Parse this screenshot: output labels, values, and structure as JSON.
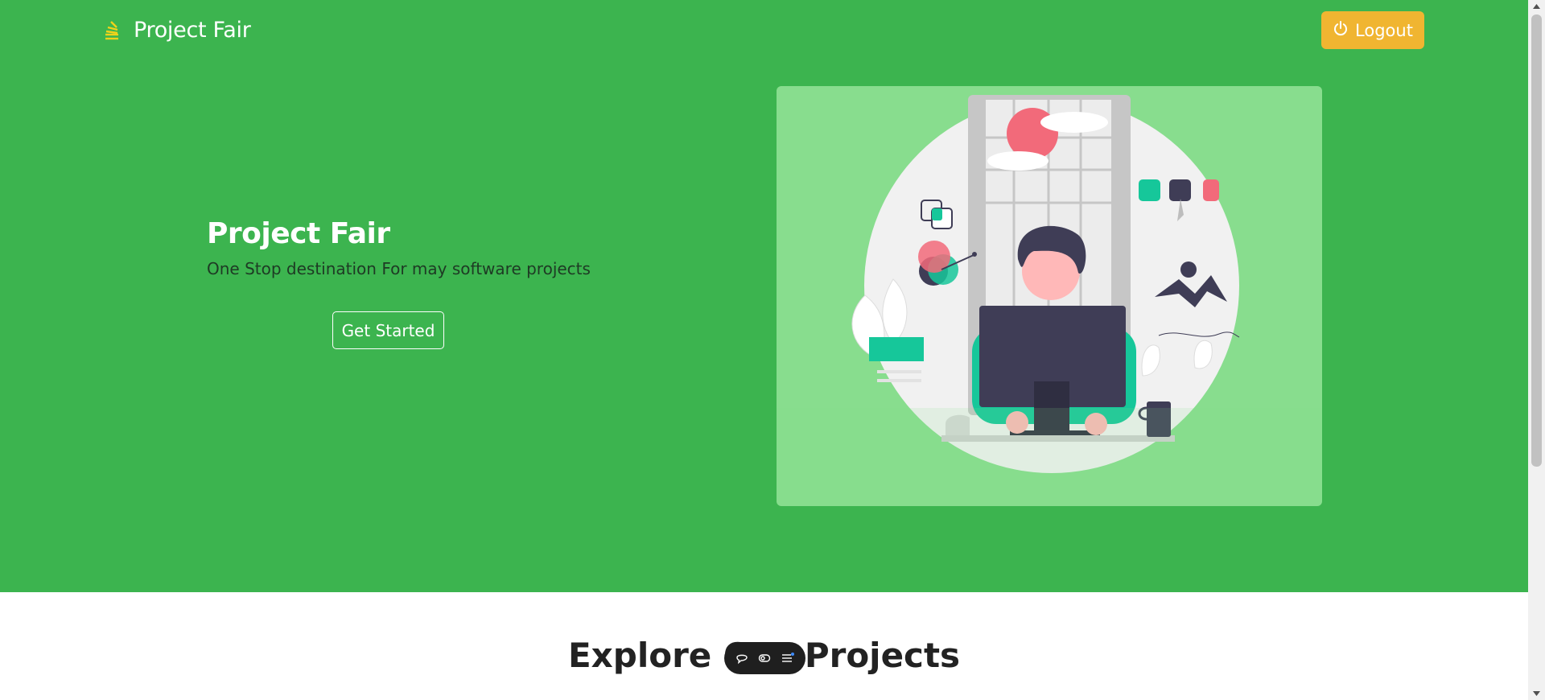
{
  "navbar": {
    "brand_text": "Project Fair",
    "brand_icon": "stack-icon",
    "logout_label": "Logout",
    "logout_icon": "power-icon"
  },
  "hero": {
    "title": "Project Fair",
    "subtitle": "One Stop destination For may software projects",
    "cta_label": "Get Started",
    "illustration": "developer-at-desk-illustration"
  },
  "section": {
    "title": "Explore Our Projects"
  },
  "toolbar": {
    "icons": [
      "chat-icon",
      "eye-toggle-icon",
      "list-icon"
    ]
  },
  "colors": {
    "hero_bg": "#3cb44f",
    "accent_button": "#f0b531",
    "illustration_bg": "#88dd8e"
  }
}
